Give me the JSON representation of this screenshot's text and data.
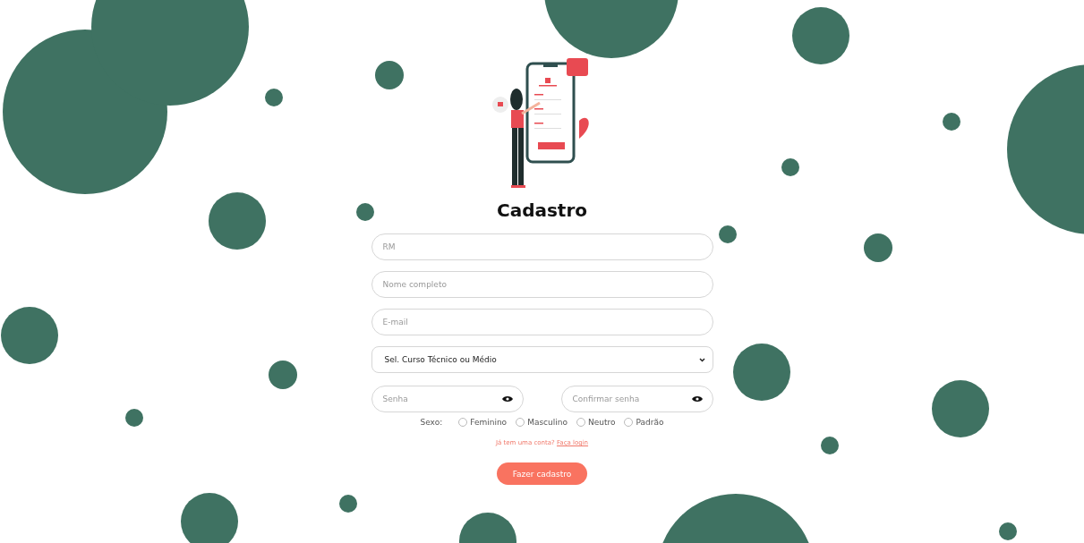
{
  "title": "Cadastro",
  "fields": [
    {
      "placeholder": "RM"
    },
    {
      "placeholder": "Nome completo"
    },
    {
      "placeholder": "E-mail"
    }
  ],
  "course_select": {
    "value": "Sel. Curso Técnico ou Médio"
  },
  "passwords": [
    {
      "placeholder": "Senha"
    },
    {
      "placeholder": "Confirmar senha"
    }
  ],
  "gender": {
    "label": "Sexo:",
    "options": [
      {
        "label": "Feminino",
        "selected": false
      },
      {
        "label": "Masculino",
        "selected": false
      },
      {
        "label": "Neutro",
        "selected": false
      },
      {
        "label": "Padrão",
        "selected": false
      }
    ]
  },
  "login_prompt": {
    "text": "Já tem uma conta?",
    "link": "Faça login"
  },
  "submit": "Fazer cadastro"
}
